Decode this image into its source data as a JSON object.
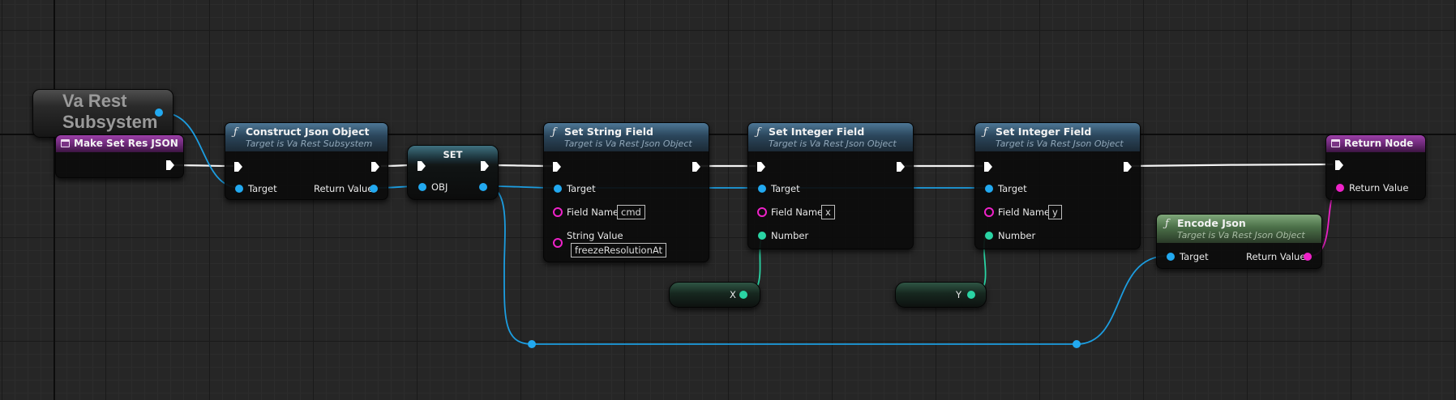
{
  "subsystem": {
    "title_line1": "Va Rest",
    "title_line2": "Subsystem"
  },
  "event_node": {
    "title": "Make Set Res JSON"
  },
  "construct": {
    "title": "Construct Json Object",
    "subtitle": "Target is Va Rest Subsystem",
    "pin_target": "Target",
    "pin_return": "Return Value"
  },
  "set_node": {
    "title": "SET",
    "pin_obj": "OBJ"
  },
  "set_string": {
    "title": "Set String Field",
    "subtitle": "Target is Va Rest Json Object",
    "pin_target": "Target",
    "pin_field_name": "Field Name",
    "field_name_value": "cmd",
    "pin_string_value": "String Value",
    "string_value": "freezeResolutionAt"
  },
  "set_int_x": {
    "title": "Set Integer Field",
    "subtitle": "Target is Va Rest Json Object",
    "pin_target": "Target",
    "pin_field_name": "Field Name",
    "field_name_value": "x",
    "pin_number": "Number"
  },
  "set_int_y": {
    "title": "Set Integer Field",
    "subtitle": "Target is Va Rest Json Object",
    "pin_target": "Target",
    "pin_field_name": "Field Name",
    "field_name_value": "y",
    "pin_number": "Number"
  },
  "var_x": {
    "label": "X"
  },
  "var_y": {
    "label": "Y"
  },
  "encode": {
    "title": "Encode Json",
    "subtitle": "Target is Va Rest Json Object",
    "pin_target": "Target",
    "pin_return": "Return Value"
  },
  "return_node": {
    "title": "Return Node",
    "pin_return": "Return Value"
  },
  "colors": {
    "exec": "#ffffff",
    "object_pin": "#22a9f0",
    "string_pin": "#ee22c8",
    "int_pin": "#2ad4a4",
    "function_header": "#3a5d78",
    "event_header": "#7a3385"
  }
}
